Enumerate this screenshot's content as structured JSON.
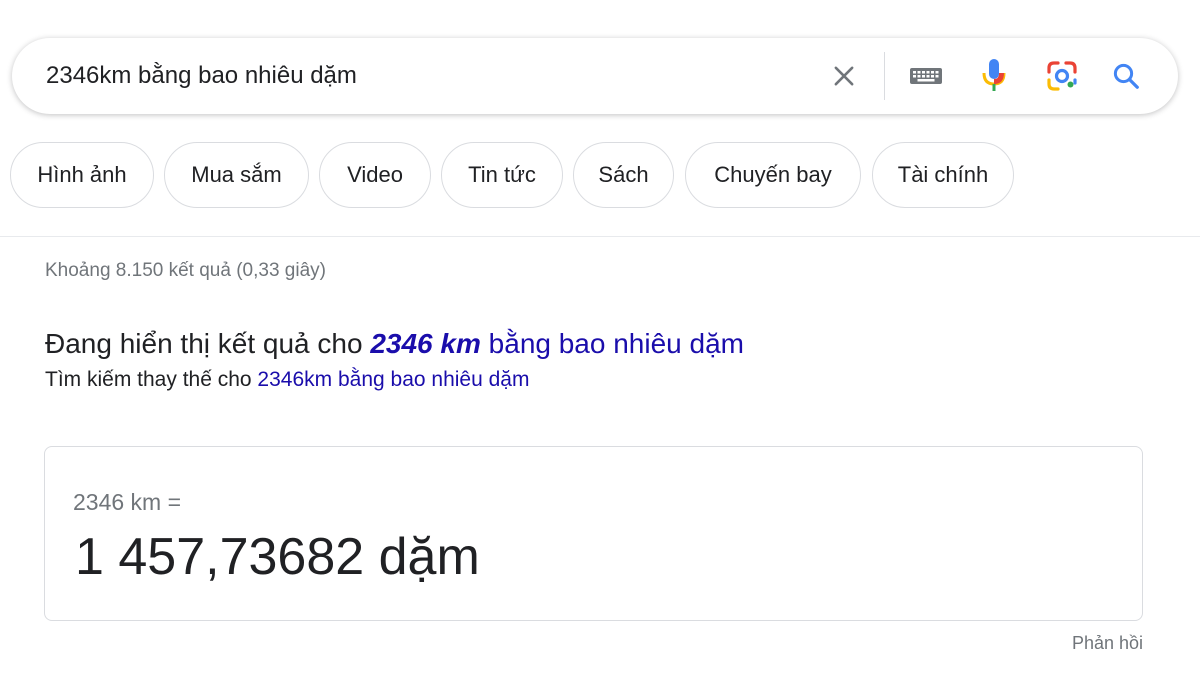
{
  "search": {
    "query": "2346km bằng bao nhiêu dặm"
  },
  "icons": {
    "clear": "close-icon",
    "keyboard": "keyboard-icon",
    "mic": "microphone-icon",
    "lens": "google-lens-icon",
    "search": "search-icon"
  },
  "chips": [
    {
      "label": "Hình ảnh"
    },
    {
      "label": "Mua sắm"
    },
    {
      "label": "Video"
    },
    {
      "label": "Tin tức"
    },
    {
      "label": "Sách"
    },
    {
      "label": "Chuyến bay"
    },
    {
      "label": "Tài chính"
    }
  ],
  "results": {
    "stats": "Khoảng 8.150 kết quả (0,33 giây)"
  },
  "spelling": {
    "prefix": "Đang hiển thị kết quả cho ",
    "corrected_bold": "2346 km",
    "corrected_rest": " bằng bao nhiêu dặm",
    "alt_prefix": "Tìm kiếm thay thế cho ",
    "alt_query": "2346km bằng bao nhiêu dặm"
  },
  "converter": {
    "input": "2346 km =",
    "result": "1 457,73682 dặm"
  },
  "feedback": "Phản hồi",
  "colors": {
    "link": "#1a0dab",
    "mic_blue": "#4285f4",
    "mic_red": "#ea4335",
    "lens_yellow": "#fbbc05",
    "lens_green": "#34a853",
    "search_blue": "#4285f4"
  }
}
